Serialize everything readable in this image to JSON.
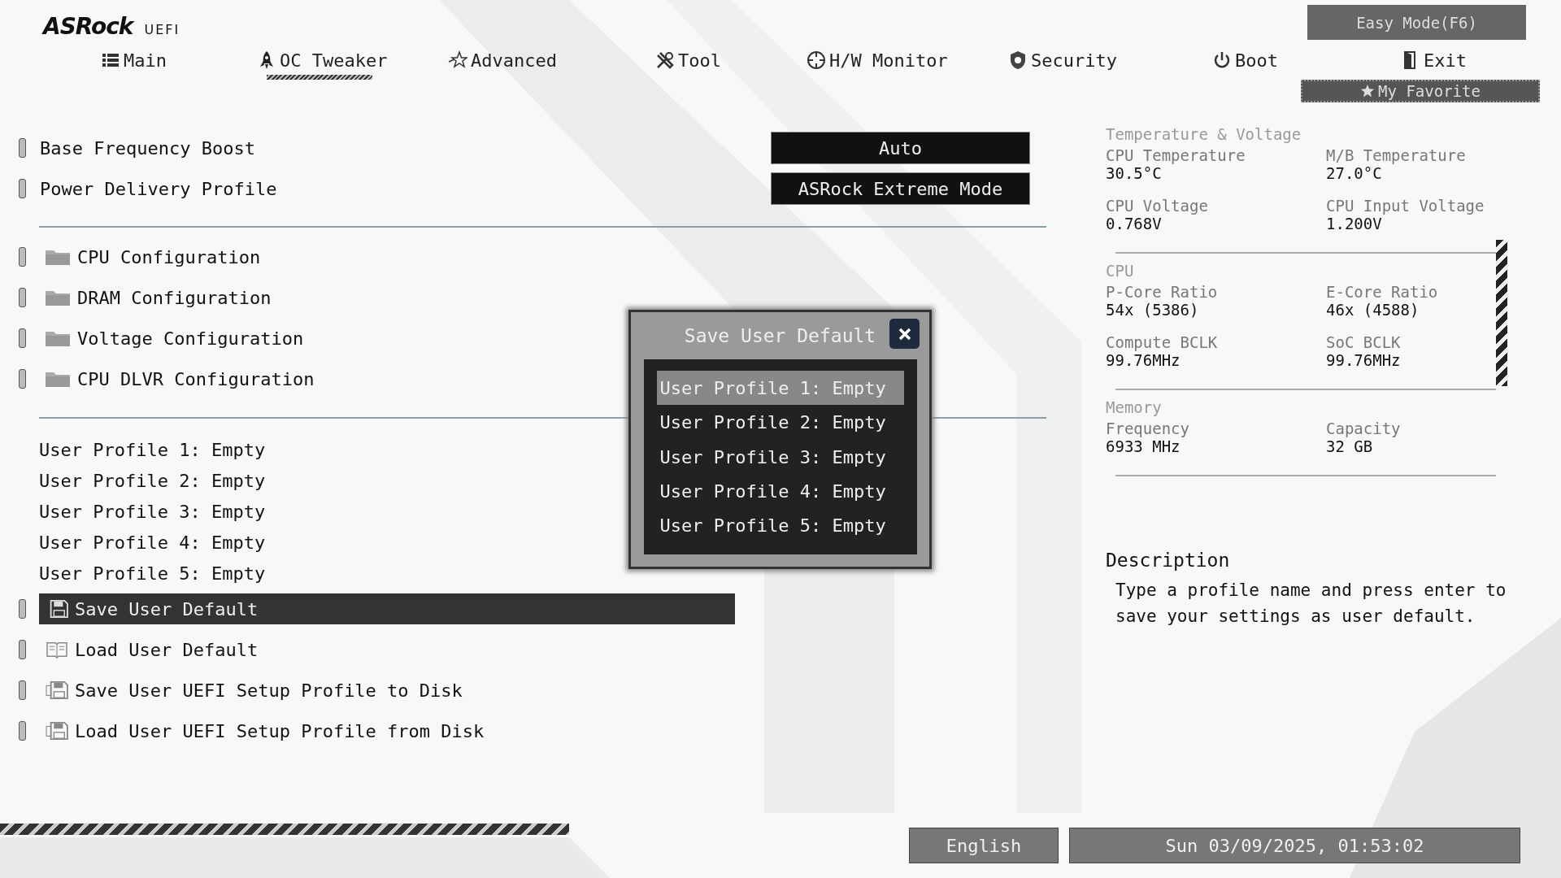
{
  "header": {
    "logo": "ASRock",
    "logo_sub": "UEFI",
    "easy_mode": "Easy Mode(F6)",
    "my_favorite": "My Favorite"
  },
  "tabs": [
    {
      "label": "Main",
      "selected": false
    },
    {
      "label": "OC Tweaker",
      "selected": true
    },
    {
      "label": "Advanced",
      "selected": false
    },
    {
      "label": "Tool",
      "selected": false
    },
    {
      "label": "H/W Monitor",
      "selected": false
    },
    {
      "label": "Security",
      "selected": false
    },
    {
      "label": "Boot",
      "selected": false
    },
    {
      "label": "Exit",
      "selected": false
    }
  ],
  "settings": [
    {
      "label": "Base Frequency Boost",
      "value": "Auto"
    },
    {
      "label": "Power Delivery Profile",
      "value": "ASRock Extreme Mode"
    }
  ],
  "submenus": [
    "CPU Configuration",
    "DRAM Configuration",
    "Voltage Configuration",
    "CPU DLVR Configuration"
  ],
  "profiles": [
    "User Profile 1: Empty",
    "User Profile 2: Empty",
    "User Profile 3: Empty",
    "User Profile 4: Empty",
    "User Profile 5: Empty"
  ],
  "actions": [
    {
      "label": "Save User Default",
      "selected": true
    },
    {
      "label": "Load User Default",
      "selected": false
    },
    {
      "label": "Save User UEFI Setup Profile to Disk",
      "selected": false
    },
    {
      "label": "Load User UEFI Setup Profile from Disk",
      "selected": false
    }
  ],
  "dialog": {
    "title": "Save User Default",
    "items": [
      {
        "label": "User Profile 1: Empty",
        "selected": true
      },
      {
        "label": "User Profile 2: Empty",
        "selected": false
      },
      {
        "label": "User Profile 3: Empty",
        "selected": false
      },
      {
        "label": "User Profile 4: Empty",
        "selected": false
      },
      {
        "label": "User Profile 5: Empty",
        "selected": false
      }
    ]
  },
  "hw_monitor": [
    {
      "title": "Temperature & Voltage",
      "items": [
        {
          "label": "CPU Temperature",
          "value": "30.5°C"
        },
        {
          "label": "M/B Temperature",
          "value": "27.0°C"
        },
        {
          "label": "CPU Voltage",
          "value": "0.768V"
        },
        {
          "label": "CPU Input Voltage",
          "value": "1.200V"
        }
      ]
    },
    {
      "title": "CPU",
      "items": [
        {
          "label": "P-Core Ratio",
          "value": "54x (5386)"
        },
        {
          "label": "E-Core Ratio",
          "value": "46x (4588)"
        },
        {
          "label": "Compute BCLK",
          "value": "99.76MHz"
        },
        {
          "label": "SoC BCLK",
          "value": "99.76MHz"
        }
      ]
    },
    {
      "title": "Memory",
      "items": [
        {
          "label": "Frequency",
          "value": "6933 MHz"
        },
        {
          "label": "Capacity",
          "value": "32 GB"
        }
      ]
    }
  ],
  "description": {
    "title": "Description",
    "text": "Type a profile name and press enter to save your settings as user default."
  },
  "footer": {
    "language": "English",
    "datetime": "Sun 03/09/2025, 01:53:02"
  }
}
